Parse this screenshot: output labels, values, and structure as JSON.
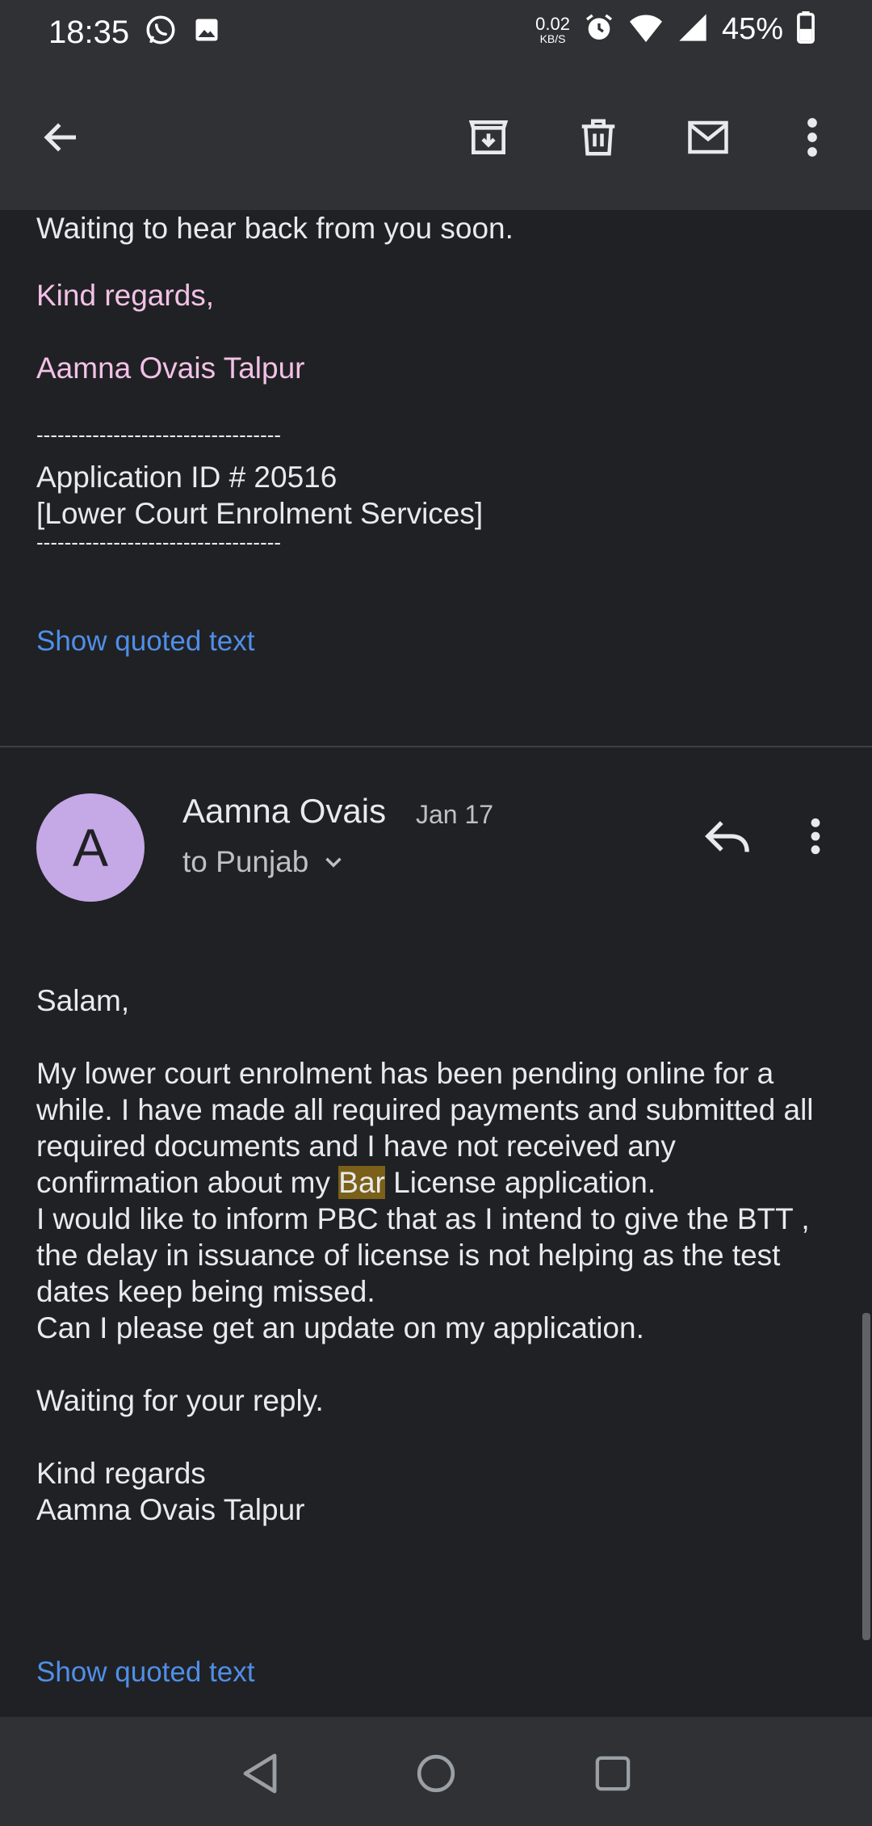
{
  "status_bar": {
    "time": "18:35",
    "net_speed_value": "0.02",
    "net_speed_unit": "KB/S",
    "battery": "45%",
    "icons": [
      "whatsapp-icon",
      "image-icon",
      "alarm-icon",
      "wifi-icon",
      "signal-icon",
      "battery-icon"
    ]
  },
  "toolbar": {
    "icons": [
      "back-arrow-icon",
      "archive-icon",
      "delete-icon",
      "mark-unread-icon",
      "more-vert-icon"
    ]
  },
  "prev_message": {
    "line1": "Waiting to hear back from you soon.",
    "regards": "Kind regards,",
    "signature": "Aamna Ovais Talpur",
    "separator": "-----------------------------------",
    "app_id": "Application ID # 20516",
    "service": "[Lower Court Enrolment Services]",
    "show_quoted": "Show quoted text"
  },
  "message": {
    "avatar_letter": "A",
    "sender": "Aamna Ovais",
    "date": "Jan 17",
    "recipient": "to Punjab",
    "greeting": "Salam,",
    "para1_a": "My lower court enrolment has been pending online for a while. I have made all required payments and submitted all required documents and I have not received any confirmation about my ",
    "para1_highlight": "Bar",
    "para1_b": " License application.",
    "para2": "I would like to inform PBC that as I intend to give the BTT , the delay in issuance of license is not helping as the test dates keep being missed.",
    "para3": "Can I please get an update on my application.",
    "para4": "Waiting for your reply.",
    "closing": "Kind regards",
    "closing_name": "Aamna Ovais Talpur",
    "show_quoted": "Show quoted text"
  },
  "colors": {
    "background": "#202124",
    "bar": "#303134",
    "link": "#4f8fe8",
    "pink_text": "#f2c1e6",
    "avatar": "#c5a8e6",
    "highlight": "#7a6018"
  }
}
